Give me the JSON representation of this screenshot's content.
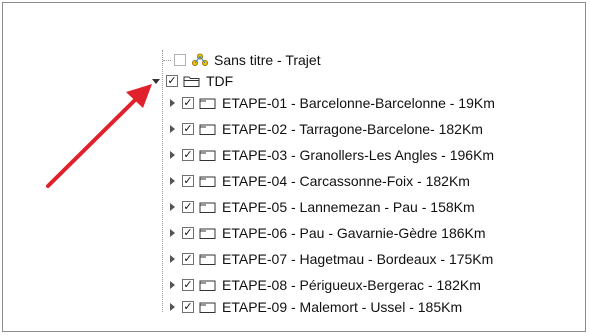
{
  "tree": {
    "trajet_item": {
      "label": "Sans titre - Trajet",
      "checked": false,
      "icon": "route-icon"
    },
    "root_item": {
      "label": "TDF",
      "checked": true,
      "icon": "folder-icon",
      "expanded": true
    },
    "stages": [
      {
        "label": "ETAPE-01 - Barcelonne-Barcelonne - 19Km"
      },
      {
        "label": "ETAPE-02 - Tarragone-Barcelone- 182Km"
      },
      {
        "label": "ETAPE-03 - Granollers-Les Angles - 196Km"
      },
      {
        "label": "ETAPE-04 - Carcassonne-Foix - 182Km"
      },
      {
        "label": "ETAPE-05 - Lannemezan - Pau - 158Km"
      },
      {
        "label": "ETAPE-06 - Pau - Gavarnie-Gèdre 186Km"
      },
      {
        "label": "ETAPE-07 - Hagetmau - Bordeaux - 175Km"
      },
      {
        "label": "ETAPE-08 - Périgueux-Bergerac - 182Km"
      },
      {
        "label": "ETAPE-09 - Malemort - Ussel - 185Km"
      }
    ]
  },
  "annotation": {
    "arrow_color": "#e0202a"
  },
  "check_glyph": "✓"
}
